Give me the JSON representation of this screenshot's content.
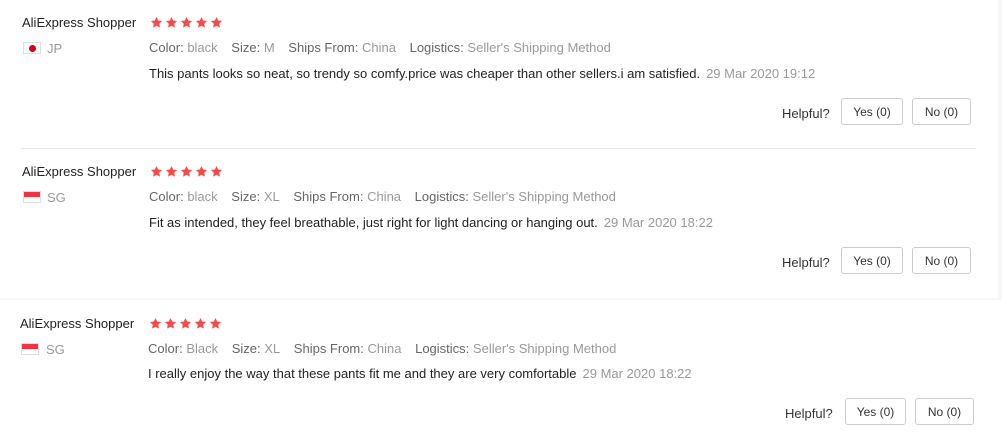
{
  "reviews": [
    {
      "user": "AliExpress Shopper",
      "rating": 5,
      "country": "JP",
      "flag": "jp",
      "attributes": [
        {
          "key": "Color:",
          "value": "black"
        },
        {
          "key": "Size:",
          "value": "M"
        },
        {
          "key": "Ships From:",
          "value": "China"
        },
        {
          "key": "Logistics:",
          "value": "Seller's Shipping Method"
        }
      ],
      "text": "This pants looks so neat, so trendy so comfy.price was cheaper than other sellers.i am satisfied.",
      "date": "29 Mar 2020 19:12",
      "helpful_label": "Helpful?",
      "yes_label": "Yes (0)",
      "no_label": "No (0)"
    },
    {
      "user": "AliExpress Shopper",
      "rating": 5,
      "country": "SG",
      "flag": "sg",
      "attributes": [
        {
          "key": "Color:",
          "value": "black"
        },
        {
          "key": "Size:",
          "value": "XL"
        },
        {
          "key": "Ships From:",
          "value": "China"
        },
        {
          "key": "Logistics:",
          "value": "Seller's Shipping Method"
        }
      ],
      "text": "Fit as intended, they feel breathable, just right for light dancing or hanging out.",
      "date": "29 Mar 2020 18:22",
      "helpful_label": "Helpful?",
      "yes_label": "Yes (0)",
      "no_label": "No (0)"
    },
    {
      "user": "AliExpress Shopper",
      "rating": 5,
      "country": "SG",
      "flag": "sg",
      "attributes": [
        {
          "key": "Color:",
          "value": "Black"
        },
        {
          "key": "Size:",
          "value": "XL"
        },
        {
          "key": "Ships From:",
          "value": "China"
        },
        {
          "key": "Logistics:",
          "value": "Seller's Shipping Method"
        }
      ],
      "text": "I really enjoy the way that these pants fit me and they are very comfortable",
      "date": "29 Mar 2020 18:22",
      "helpful_label": "Helpful?",
      "yes_label": "Yes (0)",
      "no_label": "No (0)"
    }
  ],
  "colors": {
    "star": "#f44b4b",
    "border": "#cccccc",
    "muted": "#999999"
  },
  "icons": {
    "star": "star-icon"
  }
}
